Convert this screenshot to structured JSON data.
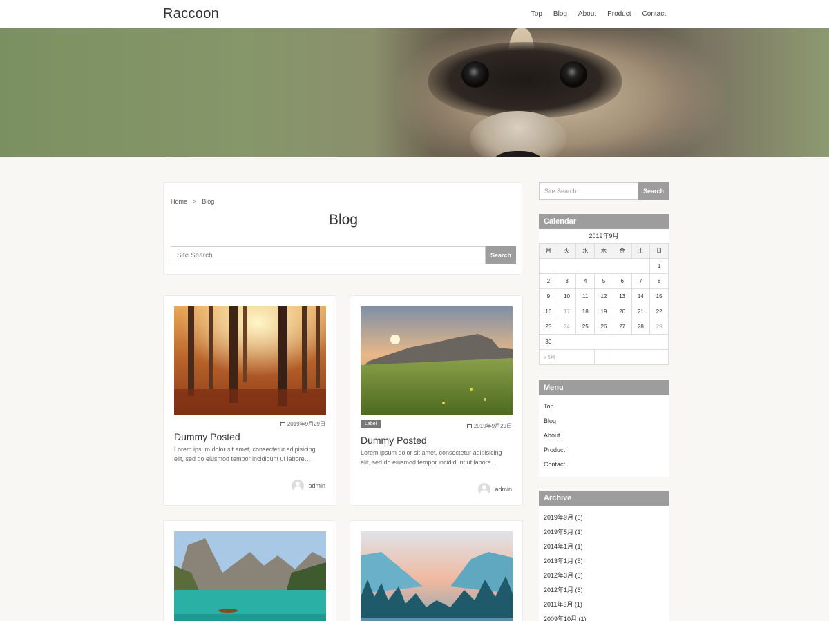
{
  "header": {
    "logo": "Raccoon",
    "nav": [
      "Top",
      "Blog",
      "About",
      "Product",
      "Contact"
    ]
  },
  "hero": {
    "image": "raccoon-face-photo"
  },
  "breadcrumb": {
    "home": "Home",
    "sep": ">",
    "current": "Blog"
  },
  "page_title": "Blog",
  "main_search": {
    "placeholder": "Site Search",
    "button": "Search"
  },
  "posts": [
    {
      "image": "autumn-forest-photo",
      "date": "2019年9月29日",
      "label": "",
      "title": "Dummy Posted",
      "excerpt": "Lorem ipsum dolor sit amet, consectetur adipisicing elit, sed do eiusmod tempor incididunt ut labore…",
      "author": "admin"
    },
    {
      "image": "mountain-meadow-sunset-photo",
      "date": "2019年9月29日",
      "label": "Label",
      "title": "Dummy Posted",
      "excerpt": "Lorem ipsum dolor sit amet, consectetur adipisicing elit, sed do eiusmod tempor incididunt ut labore…",
      "author": "admin"
    },
    {
      "image": "mountain-lake-boat-photo"
    },
    {
      "image": "valley-forest-river-photo"
    }
  ],
  "sidebar": {
    "search": {
      "placeholder": "Site Search",
      "button": "Search"
    },
    "calendar": {
      "title": "Calendar",
      "month": "2019年9月",
      "weekdays": [
        "月",
        "火",
        "水",
        "木",
        "金",
        "土",
        "日"
      ],
      "days": [
        "1",
        "2",
        "3",
        "4",
        "5",
        "6",
        "7",
        "8",
        "9",
        "10",
        "11",
        "12",
        "13",
        "14",
        "15",
        "16",
        "17",
        "18",
        "19",
        "20",
        "21",
        "22",
        "23",
        "24",
        "25",
        "26",
        "27",
        "28",
        "29",
        "30"
      ],
      "prev_link": "« 5月"
    },
    "menu": {
      "title": "Menu",
      "items": [
        "Top",
        "Blog",
        "About",
        "Product",
        "Contact"
      ]
    },
    "archive": {
      "title": "Archive",
      "items": [
        "2019年9月 (6)",
        "2019年5月 (1)",
        "2014年1月 (1)",
        "2013年1月 (5)",
        "2012年3月 (5)",
        "2012年1月 (6)",
        "2011年3月 (1)",
        "2009年10月 (1)"
      ]
    }
  },
  "colors": {
    "widget_header": "#9d9d9d",
    "page_bg": "#f8f7f3",
    "label_badge": "#777777"
  }
}
